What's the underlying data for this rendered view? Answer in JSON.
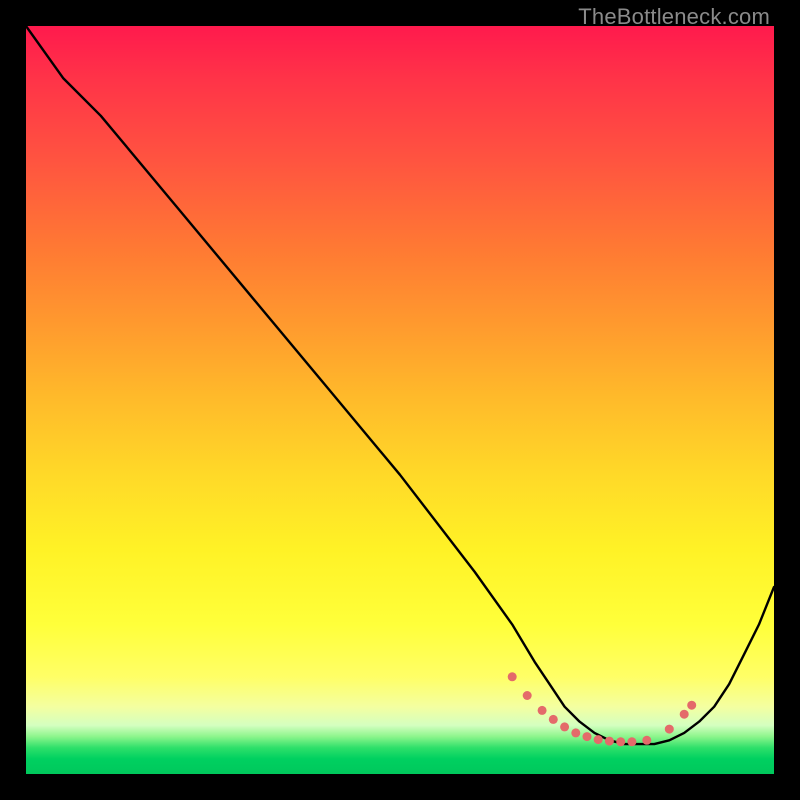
{
  "watermark": "TheBottleneck.com",
  "chart_data": {
    "type": "line",
    "title": "",
    "xlabel": "",
    "ylabel": "",
    "xlim": [
      0,
      100
    ],
    "ylim": [
      0,
      100
    ],
    "series": [
      {
        "name": "curve",
        "x": [
          0,
          5,
          10,
          20,
          30,
          40,
          50,
          60,
          65,
          68,
          70,
          72,
          74,
          76,
          78,
          80,
          82,
          84,
          86,
          88,
          90,
          92,
          94,
          96,
          98,
          100
        ],
        "y": [
          100,
          93,
          88,
          76,
          64,
          52,
          40,
          27,
          20,
          15,
          12,
          9,
          7,
          5.5,
          4.5,
          4,
          4,
          4,
          4.5,
          5.5,
          7,
          9,
          12,
          16,
          20,
          25
        ]
      }
    ],
    "markers": {
      "name": "dots",
      "x": [
        65,
        67,
        69,
        70.5,
        72,
        73.5,
        75,
        76.5,
        78,
        79.5,
        81,
        83,
        86,
        88,
        89
      ],
      "y": [
        13,
        10.5,
        8.5,
        7.3,
        6.3,
        5.5,
        5,
        4.6,
        4.4,
        4.3,
        4.3,
        4.5,
        6,
        8,
        9.2
      ],
      "color": "#e46a6a",
      "size": 9
    },
    "gradient_stops": [
      {
        "pos": 0,
        "color": "#ff1a4d"
      },
      {
        "pos": 0.5,
        "color": "#ffd928"
      },
      {
        "pos": 0.87,
        "color": "#ffff66"
      },
      {
        "pos": 0.96,
        "color": "#2ee06a"
      },
      {
        "pos": 1.0,
        "color": "#00c85c"
      }
    ]
  }
}
